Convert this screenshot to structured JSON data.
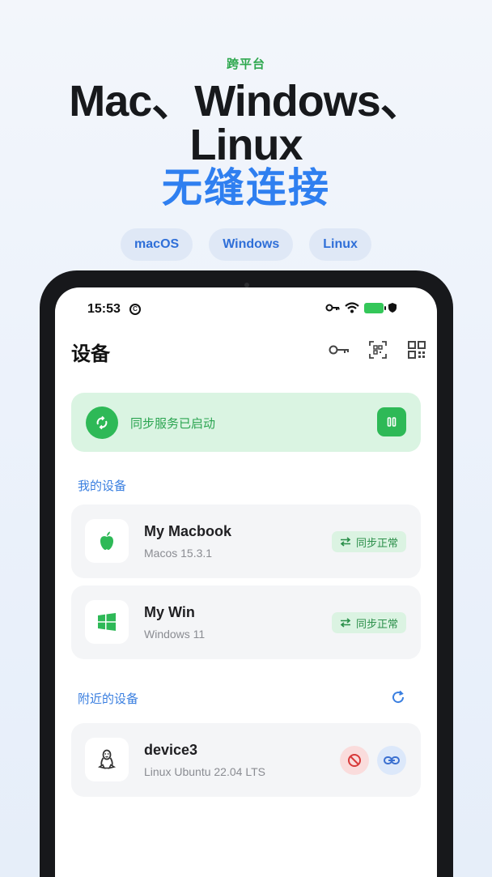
{
  "hero": {
    "eyebrow": "跨平台",
    "title_line1": "Mac、Windows、",
    "title_line2": "Linux",
    "title_line3": "无缝连接",
    "pills": [
      "macOS",
      "Windows",
      "Linux"
    ]
  },
  "status_bar": {
    "time": "15:53",
    "notification_glyph": "C"
  },
  "header": {
    "title": "设备"
  },
  "sync_banner": {
    "text": "同步服务已启动"
  },
  "my_devices": {
    "title": "我的设备",
    "items": [
      {
        "name": "My Macbook",
        "subtitle": "Macos 15.3.1",
        "status": "同步正常",
        "icon": "apple-icon"
      },
      {
        "name": "My Win",
        "subtitle": "Windows 11",
        "status": "同步正常",
        "icon": "windows-icon"
      }
    ]
  },
  "nearby_devices": {
    "title": "附近的设备",
    "items": [
      {
        "name": "device3",
        "subtitle": "Linux Ubuntu 22.04 LTS",
        "icon": "linux-icon"
      }
    ]
  },
  "colors": {
    "accent_green": "#2eb957",
    "accent_blue": "#2f7ff0",
    "danger": "#e03a3a"
  }
}
